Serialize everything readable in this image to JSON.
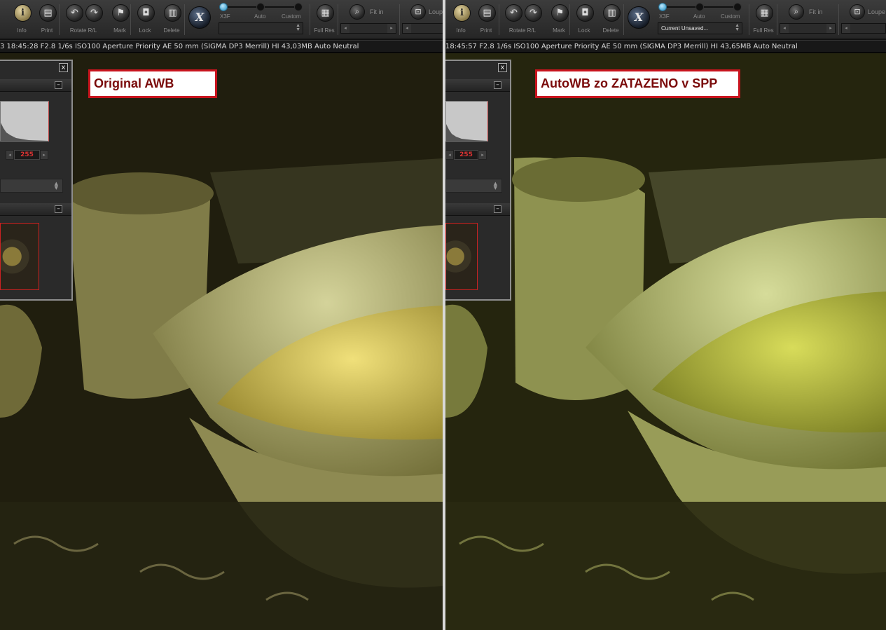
{
  "toolbar": {
    "info": "Info",
    "print": "Print",
    "rotate": "Rotate R/L",
    "mark": "Mark",
    "lock": "Lock",
    "delete": "Delete",
    "x_logo": "X",
    "x3f": "X3F",
    "auto": "Auto",
    "custom": "Custom",
    "full_res": "Full Res",
    "fit_in": "Fit in",
    "loupe": "Loupe"
  },
  "left_pane": {
    "preset_value": "",
    "info_line": "3 18:45:28 F2.8 1/6s ISO100 Aperture Priority AE 50 mm (SIGMA DP3 Merrill) HI 43,03MB Auto Neutral",
    "histogram_value": "255",
    "caption": "Original AWB"
  },
  "right_pane": {
    "preset_value": "Current Unsaved...",
    "info_line": "18:45:57 F2.8 1/6s ISO100 Aperture Priority AE 50 mm (SIGMA DP3 Merrill) HI 43,65MB Auto Neutral",
    "histogram_value": "255",
    "caption": "AutoWB zo ZATAZENO v SPP"
  },
  "palette": {
    "close": "x",
    "minimize": "–"
  },
  "colors": {
    "label_border": "#c8141e",
    "label_text": "#7a0a0a",
    "slider_active": "#4aa6d0"
  },
  "icons": [
    "info-icon",
    "print-icon",
    "rotate-left-icon",
    "rotate-right-icon",
    "flag-icon",
    "lock-icon",
    "trash-icon",
    "x-logo-icon",
    "full-res-icon",
    "magnifier-icon",
    "loupe-icon"
  ]
}
